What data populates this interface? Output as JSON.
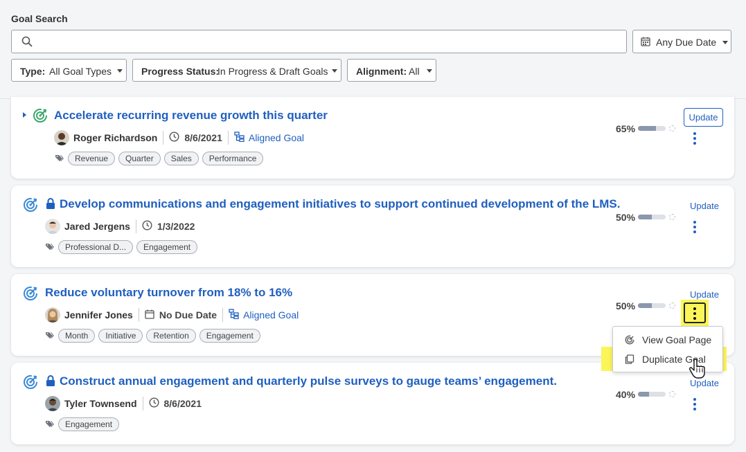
{
  "search": {
    "title": "Goal Search",
    "placeholder": "",
    "due_date": "Any Due Date"
  },
  "filters": [
    {
      "label": "Type:",
      "value": "All Goal Types"
    },
    {
      "label": "Progress Status:",
      "value": "In Progress & Draft Goals"
    },
    {
      "label": "Alignment:",
      "value": "All"
    }
  ],
  "goals": [
    {
      "title": "Accelerate recurring revenue growth this quarter",
      "owner": "Roger Richardson",
      "due": "8/6/2021",
      "alignment": "Aligned Goal",
      "tags": [
        "Revenue",
        "Quarter",
        "Sales",
        "Performance"
      ],
      "progress_label": "65%",
      "progress": 0.65,
      "update_label": "Update",
      "locked": false
    },
    {
      "title": "Develop communications and engagement initiatives to support continued development of the LMS.",
      "owner": "Jared Jergens",
      "due": "1/3/2022",
      "tags": [
        "Professional D...",
        "Engagement"
      ],
      "progress_label": "50%",
      "progress": 0.5,
      "update_label": "Update",
      "locked": true
    },
    {
      "title": "Reduce voluntary turnover from 18% to 16%",
      "owner": "Jennifer Jones",
      "due": "No Due Date",
      "alignment": "Aligned Goal",
      "tags": [
        "Month",
        "Initiative",
        "Retention",
        "Engagement"
      ],
      "progress_label": "50%",
      "progress": 0.5,
      "update_label": "Update",
      "locked": false
    },
    {
      "title": "Construct annual engagement and quarterly pulse surveys to gauge teams’ engagement.",
      "owner": "Tyler Townsend",
      "due": "8/6/2021",
      "tags": [
        "Engagement"
      ],
      "progress_label": "40%",
      "progress": 0.4,
      "update_label": "Update",
      "locked": true
    }
  ],
  "menu": {
    "items": [
      {
        "label": "View Goal Page",
        "icon": "goal-target-icon"
      },
      {
        "label": "Duplicate Goal",
        "icon": "duplicate-icon"
      }
    ]
  },
  "colors": {
    "accent": "#1f5fbf",
    "highlight": "#fbf55a",
    "progress_fill": "#8a97ad",
    "goal_icon": "#3a8ad6",
    "completed_goal_icon": "#3aa86b"
  }
}
